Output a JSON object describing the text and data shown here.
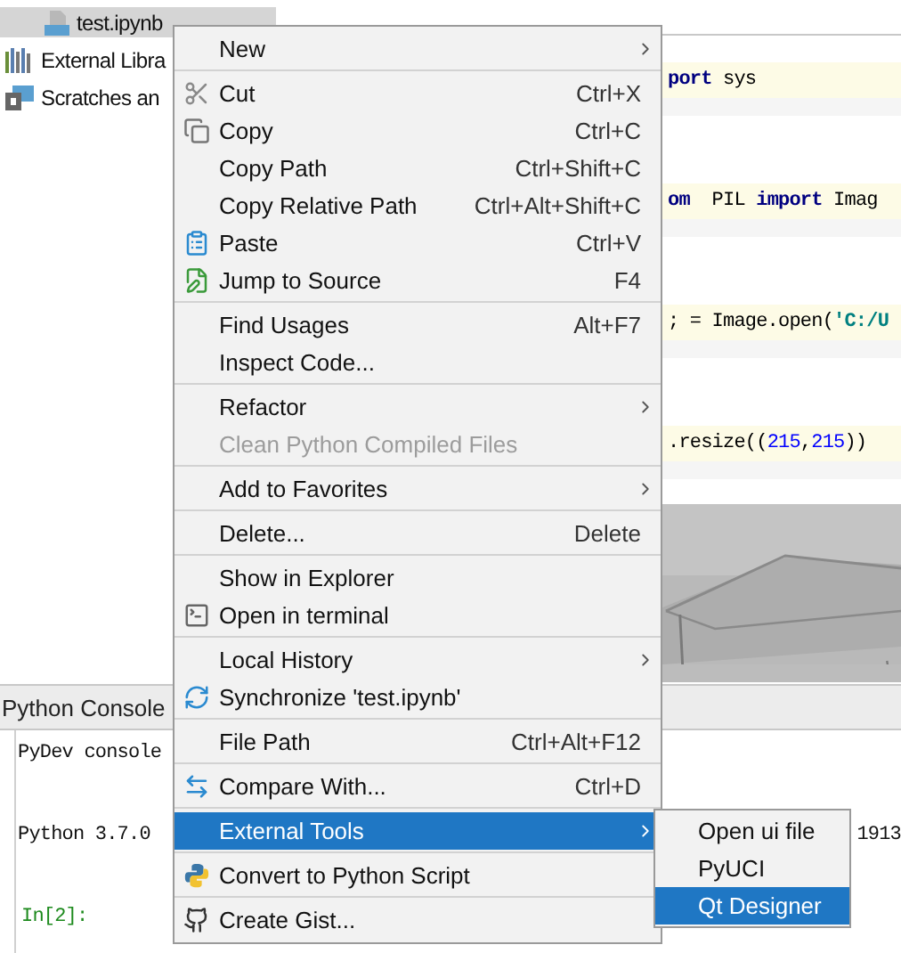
{
  "project_tree": [
    {
      "label": "test.ipynb",
      "selected": true
    },
    {
      "label": "External Libra",
      "selected": false
    },
    {
      "label": "Scratches an",
      "selected": false
    }
  ],
  "editor": {
    "cells": [
      {
        "kind": "code",
        "tokens": [
          {
            "t": "port",
            "kind": "keyword"
          },
          {
            "t": " sys",
            "kind": "plain"
          }
        ]
      },
      {
        "kind": "code",
        "tokens": [
          {
            "t": "om",
            "kind": "keyword"
          },
          {
            "t": "  PIL ",
            "kind": "plain"
          },
          {
            "t": "import",
            "kind": "keyword"
          },
          {
            "t": " Imag",
            "kind": "plain"
          }
        ]
      },
      {
        "kind": "code",
        "tokens": [
          {
            "t": "; = Image.open(",
            "kind": "plain"
          },
          {
            "t": "'C:/U",
            "kind": "string"
          }
        ]
      },
      {
        "kind": "code",
        "tokens": [
          {
            "t": ".resize((",
            "kind": "plain"
          },
          {
            "t": "215",
            "kind": "number"
          },
          {
            "t": ",",
            "kind": "plain"
          },
          {
            "t": "215",
            "kind": "number"
          },
          {
            "t": "))",
            "kind": "plain"
          }
        ]
      },
      {
        "kind": "picture"
      }
    ]
  },
  "console": {
    "title": "Python Console",
    "lines": [
      {
        "kind": "output",
        "text": "PyDev console"
      },
      {
        "kind": "output",
        "text": "Python 3.7.0",
        "tail": "1913"
      },
      {
        "kind": "prompt",
        "text": "In[2]:"
      }
    ]
  },
  "context_menu": {
    "items": [
      {
        "kind": "item",
        "label": "New",
        "submenu": true,
        "disabled": false,
        "selected": false
      },
      {
        "kind": "separator"
      },
      {
        "kind": "item",
        "label": "Cut",
        "shortcut": "Ctrl+X",
        "submenu": false,
        "disabled": false,
        "selected": false
      },
      {
        "kind": "item",
        "label": "Copy",
        "shortcut": "Ctrl+C",
        "submenu": false,
        "disabled": false,
        "selected": false
      },
      {
        "kind": "item",
        "label": "Copy Path",
        "shortcut": "Ctrl+Shift+C",
        "submenu": false,
        "disabled": false,
        "selected": false
      },
      {
        "kind": "item",
        "label": "Copy Relative Path",
        "shortcut": "Ctrl+Alt+Shift+C",
        "submenu": false,
        "disabled": false,
        "selected": false
      },
      {
        "kind": "item",
        "label": "Paste",
        "shortcut": "Ctrl+V",
        "submenu": false,
        "disabled": false,
        "selected": false
      },
      {
        "kind": "item",
        "label": "Jump to Source",
        "shortcut": "F4",
        "submenu": false,
        "disabled": false,
        "selected": false
      },
      {
        "kind": "separator"
      },
      {
        "kind": "item",
        "label": "Find Usages",
        "shortcut": "Alt+F7",
        "submenu": false,
        "disabled": false,
        "selected": false
      },
      {
        "kind": "item",
        "label": "Inspect Code...",
        "submenu": false,
        "disabled": false,
        "selected": false
      },
      {
        "kind": "separator"
      },
      {
        "kind": "item",
        "label": "Refactor",
        "submenu": true,
        "disabled": false,
        "selected": false
      },
      {
        "kind": "item",
        "label": "Clean Python Compiled Files",
        "submenu": false,
        "disabled": true,
        "selected": false
      },
      {
        "kind": "separator"
      },
      {
        "kind": "item",
        "label": "Add to Favorites",
        "submenu": true,
        "disabled": false,
        "selected": false
      },
      {
        "kind": "separator"
      },
      {
        "kind": "item",
        "label": "Delete...",
        "shortcut": "Delete",
        "submenu": false,
        "disabled": false,
        "selected": false
      },
      {
        "kind": "separator"
      },
      {
        "kind": "item",
        "label": "Show in Explorer",
        "submenu": false,
        "disabled": false,
        "selected": false
      },
      {
        "kind": "item",
        "label": "Open in terminal",
        "submenu": false,
        "disabled": false,
        "selected": false
      },
      {
        "kind": "separator"
      },
      {
        "kind": "item",
        "label": "Local History",
        "submenu": true,
        "disabled": false,
        "selected": false
      },
      {
        "kind": "item",
        "label": "Synchronize 'test.ipynb'",
        "submenu": false,
        "disabled": false,
        "selected": false
      },
      {
        "kind": "separator"
      },
      {
        "kind": "item",
        "label": "File Path",
        "shortcut": "Ctrl+Alt+F12",
        "submenu": false,
        "disabled": false,
        "selected": false
      },
      {
        "kind": "separator"
      },
      {
        "kind": "item",
        "label": "Compare With...",
        "shortcut": "Ctrl+D",
        "submenu": false,
        "disabled": false,
        "selected": false
      },
      {
        "kind": "separator"
      },
      {
        "kind": "item",
        "label": "External Tools",
        "submenu": true,
        "disabled": false,
        "selected": true
      },
      {
        "kind": "separator"
      },
      {
        "kind": "item",
        "label": "Convert to Python Script",
        "submenu": false,
        "disabled": false,
        "selected": false
      },
      {
        "kind": "separator"
      },
      {
        "kind": "item",
        "label": "Create Gist...",
        "submenu": false,
        "disabled": false,
        "selected": false
      }
    ]
  },
  "submenu": {
    "items": [
      {
        "label": "Open ui file",
        "selected": false
      },
      {
        "label": "PyUCI",
        "selected": false
      },
      {
        "label": "Qt Designer",
        "selected": true
      }
    ]
  }
}
